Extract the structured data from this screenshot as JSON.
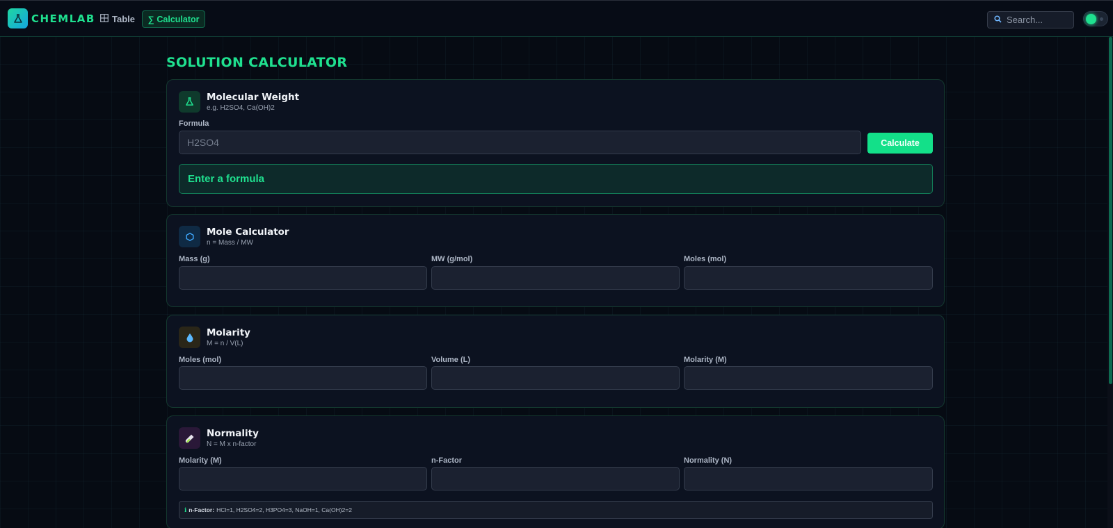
{
  "header": {
    "brand": "CHEMLAB",
    "nav": [
      {
        "label": "Table",
        "icon": "grid-icon"
      },
      {
        "label": "Calculator",
        "icon": "sigma-icon",
        "active": true
      }
    ],
    "search_placeholder": "Search...",
    "theme_toggle_on": true
  },
  "page_title": "SOLUTION CALCULATOR",
  "molecular_weight": {
    "title": "Molecular Weight",
    "subtitle": "e.g. H2SO4, Ca(OH)2",
    "formula_label": "Formula",
    "formula_placeholder": "H2SO4",
    "calculate_label": "Calculate",
    "result_text": "Enter a formula"
  },
  "mole": {
    "title": "Mole Calculator",
    "subtitle": "n = Mass / MW",
    "fields": [
      "Mass (g)",
      "MW (g/mol)",
      "Moles (mol)"
    ]
  },
  "molarity": {
    "title": "Molarity",
    "subtitle": "M = n / V(L)",
    "fields": [
      "Moles (mol)",
      "Volume (L)",
      "Molarity (M)"
    ]
  },
  "normality": {
    "title": "Normality",
    "subtitle": "N = M x n-factor",
    "fields": [
      "Molarity (M)",
      "n-Factor",
      "Normality (N)"
    ],
    "info_label": "n-Factor:",
    "info_text": "HCl=1, H2SO4=2, H3PO4=3, NaOH=1, Ca(OH)2=2"
  },
  "colors": {
    "accent": "#1fe08f",
    "background": "#060b13",
    "card": "#0c1220",
    "field": "#1b2130"
  }
}
